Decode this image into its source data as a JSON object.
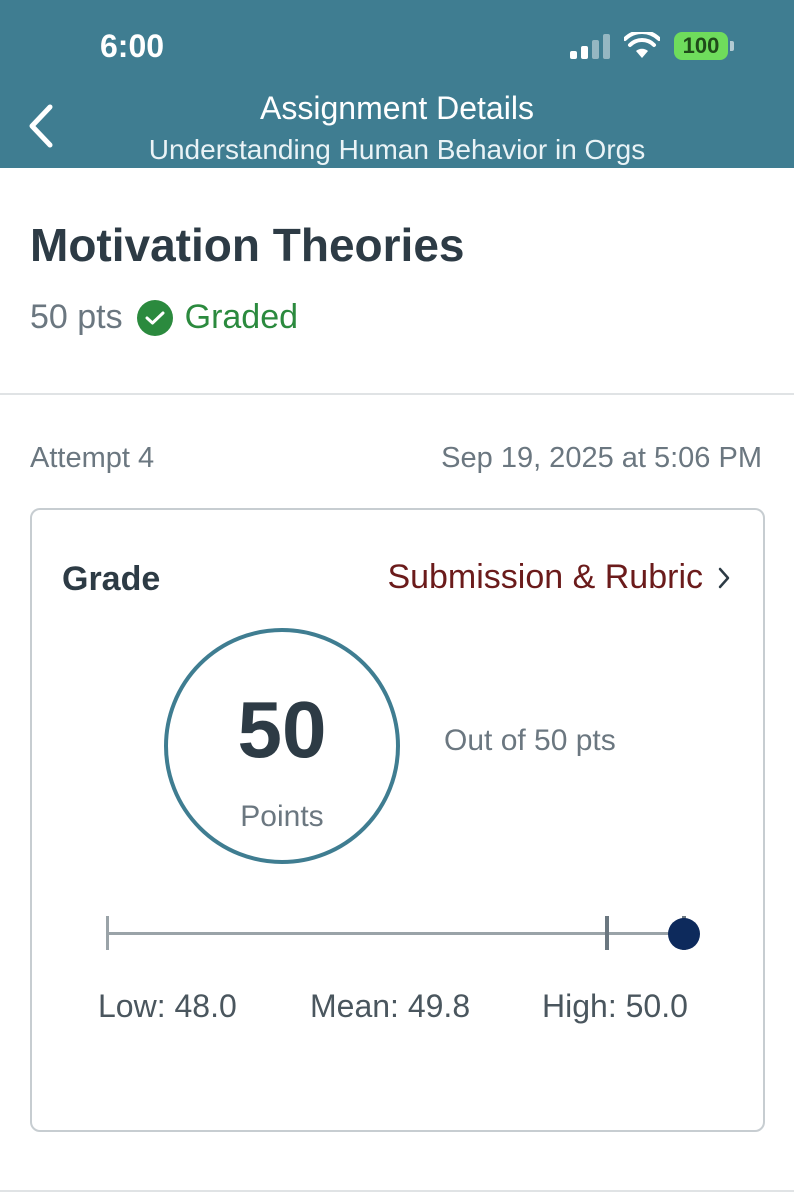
{
  "status_bar": {
    "time": "6:00",
    "battery": "100"
  },
  "nav": {
    "title": "Assignment Details",
    "subtitle": "Understanding Human Behavior in Orgs"
  },
  "assignment": {
    "title": "Motivation Theories",
    "points": "50 pts",
    "status": "Graded"
  },
  "submission": {
    "attempt": "Attempt 4",
    "date": "Sep 19, 2025 at 5:06 PM"
  },
  "grade_card": {
    "label": "Grade",
    "rubric_link": "Submission & Rubric",
    "score": "50",
    "score_unit": "Points",
    "out_of": "Out of 50 pts",
    "stats": {
      "low_label": "Low: 48.0",
      "mean_label": "Mean: 49.8",
      "high_label": "High: 50.0",
      "low": 48.0,
      "mean": 49.8,
      "high": 50.0,
      "score": 50.0
    }
  },
  "colors": {
    "header": "#3f7d91",
    "graded": "#2b8a3e",
    "link": "#6b1b1b",
    "marker": "#0d2a5c"
  }
}
